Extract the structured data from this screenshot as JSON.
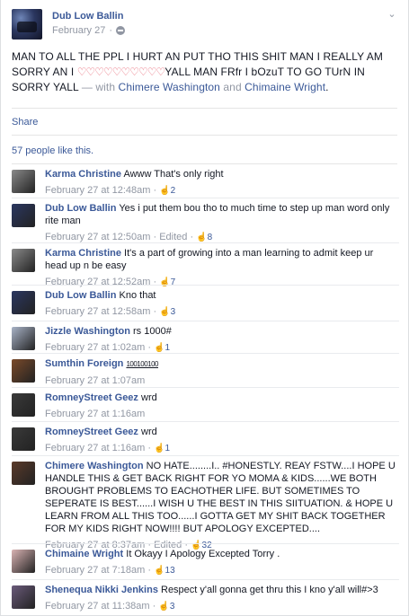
{
  "post": {
    "author": "Dub Low Ballin",
    "date": "February 27",
    "text_before": "MAN TO ALL THE PPL I HURT AN PUT THO THIS SHIT MAN I REALLY AM SORRY AN I ",
    "hearts": "♡♡♡♡♡♡♡♡♡♡",
    "text_after": "YALL MAN FRfr I bOzuT TO GO TUrN IN SORRY YALL",
    "with_word": "— with",
    "tag1": "Chimere Washington",
    "and_word": "and",
    "tag2": "Chimaine Wright",
    "tail": "."
  },
  "actions": {
    "share": "Share"
  },
  "likes": {
    "text": "57 people like this."
  },
  "comments": [
    {
      "name": "Karma Christine",
      "text": "Awww That's only right",
      "time": "February 27 at 12:48am",
      "sep": "·",
      "edited": "",
      "likes": "2",
      "avatar_color": "#8a8a8a"
    },
    {
      "name": "Dub Low Ballin",
      "text": "Yes i put them bou tho to much time to step up man word only rite man",
      "time": "February 27 at 12:50am",
      "sep": "·",
      "edited": "Edited ·",
      "likes": "8",
      "avatar_color": "#2b3760"
    },
    {
      "name": "Karma Christine",
      "text": "It's a part of growing into a man learning to admit keep ur head up n be easy",
      "time": "February 27 at 12:52am",
      "sep": "·",
      "edited": "",
      "likes": "7",
      "avatar_color": "#8a8a8a"
    },
    {
      "name": "Dub Low Ballin",
      "text": "Kno that",
      "time": "February 27 at 12:58am",
      "sep": "·",
      "edited": "",
      "likes": "3",
      "avatar_color": "#2b3760"
    },
    {
      "name": "Jizzle Washington",
      "text": "rs 1000#",
      "time": "February 27 at 1:02am",
      "sep": "·",
      "edited": "",
      "likes": "1",
      "avatar_color": "#a9b3c7"
    },
    {
      "name": "Sumthin Foreign",
      "text": "100100100",
      "time": "February 27 at 1:07am",
      "sep": "",
      "edited": "",
      "likes": "",
      "avatar_color": "#7a4a2a"
    },
    {
      "name": "RomneyStreet Geez",
      "text": "wrd",
      "time": "February 27 at 1:16am",
      "sep": "",
      "edited": "",
      "likes": "",
      "avatar_color": "#3a3a3a"
    },
    {
      "name": "RomneyStreet Geez",
      "text": "wrd",
      "time": "February 27 at 1:16am",
      "sep": "·",
      "edited": "",
      "likes": "1",
      "avatar_color": "#3a3a3a"
    },
    {
      "name": "Chimere Washington",
      "text": "NO HATE........I.. #HONESTLY. REAY FSTW....I HOPE U HANDLE THIS & GET BACK RIGHT FOR YO MOMA & KIDS......WE BOTH BROUGHT PROBLEMS TO EACHOTHER LIFE. BUT SOMETIMES TO SEPERATE IS BEST......I WISH U THE BEST IN THIS SIITUATION. & HOPE U LEARN FROM ALL THIS TOO......I GOTTA GET MY SHIT BACK TOGETHER FOR MY KIDS RIGHT NOW!!!! BUT APOLOGY EXCEPTED....",
      "time": "February 27 at 8:37am",
      "sep": "·",
      "edited": "Edited ·",
      "likes": "32",
      "avatar_color": "#5a3a2a"
    },
    {
      "name": "Chimaine Wright",
      "text": "It Okayy I Apology Excepted Torry .",
      "time": "February 27 at 7:18am",
      "sep": "·",
      "edited": "",
      "likes": "13",
      "avatar_color": "#d9b3b3"
    },
    {
      "name": "Shenequa Nikki Jenkins",
      "text": "Respect y'all gonna get thru this I kno y'all will#>3",
      "time": "February 27 at 11:38am",
      "sep": "·",
      "edited": "",
      "likes": "3",
      "avatar_color": "#6a5a7a"
    }
  ],
  "colors": {
    "link": "#3b5998",
    "meta": "#9197a3",
    "text": "#141823",
    "heart": "#e86a78"
  },
  "icons": {
    "like": "thumbs-up-icon",
    "audience": "globe-icon",
    "menu": "chevron-down-icon"
  }
}
